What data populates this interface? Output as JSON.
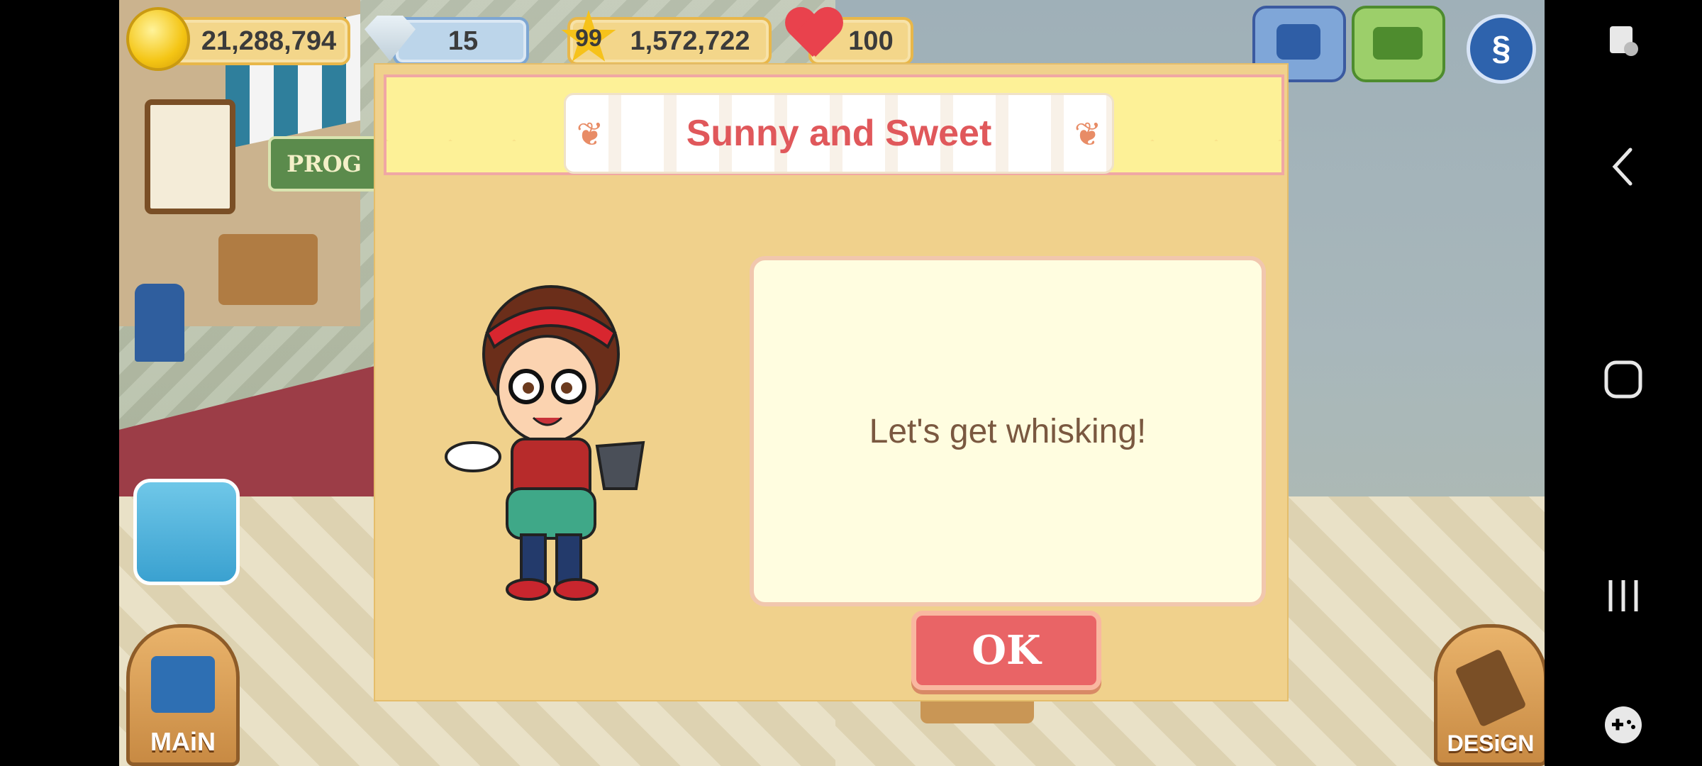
{
  "hud": {
    "coins": "21,288,794",
    "gems": "15",
    "level": "99",
    "xp": "1,572,722",
    "hearts": "100"
  },
  "scene": {
    "progress_sign": "PROG",
    "main_button": "MAiN",
    "design_button": "DESiGN"
  },
  "dialog": {
    "title": "Sunny and Sweet",
    "message": "Let's get whisking!",
    "ok_label": "OK"
  },
  "colors": {
    "title_text": "#e0585b",
    "ok_button": "#e96466",
    "panel": "#f0d18c"
  },
  "icons": {
    "phone": "phone-icon",
    "camera": "camera-icon",
    "s-badge": "s-badge-icon"
  }
}
